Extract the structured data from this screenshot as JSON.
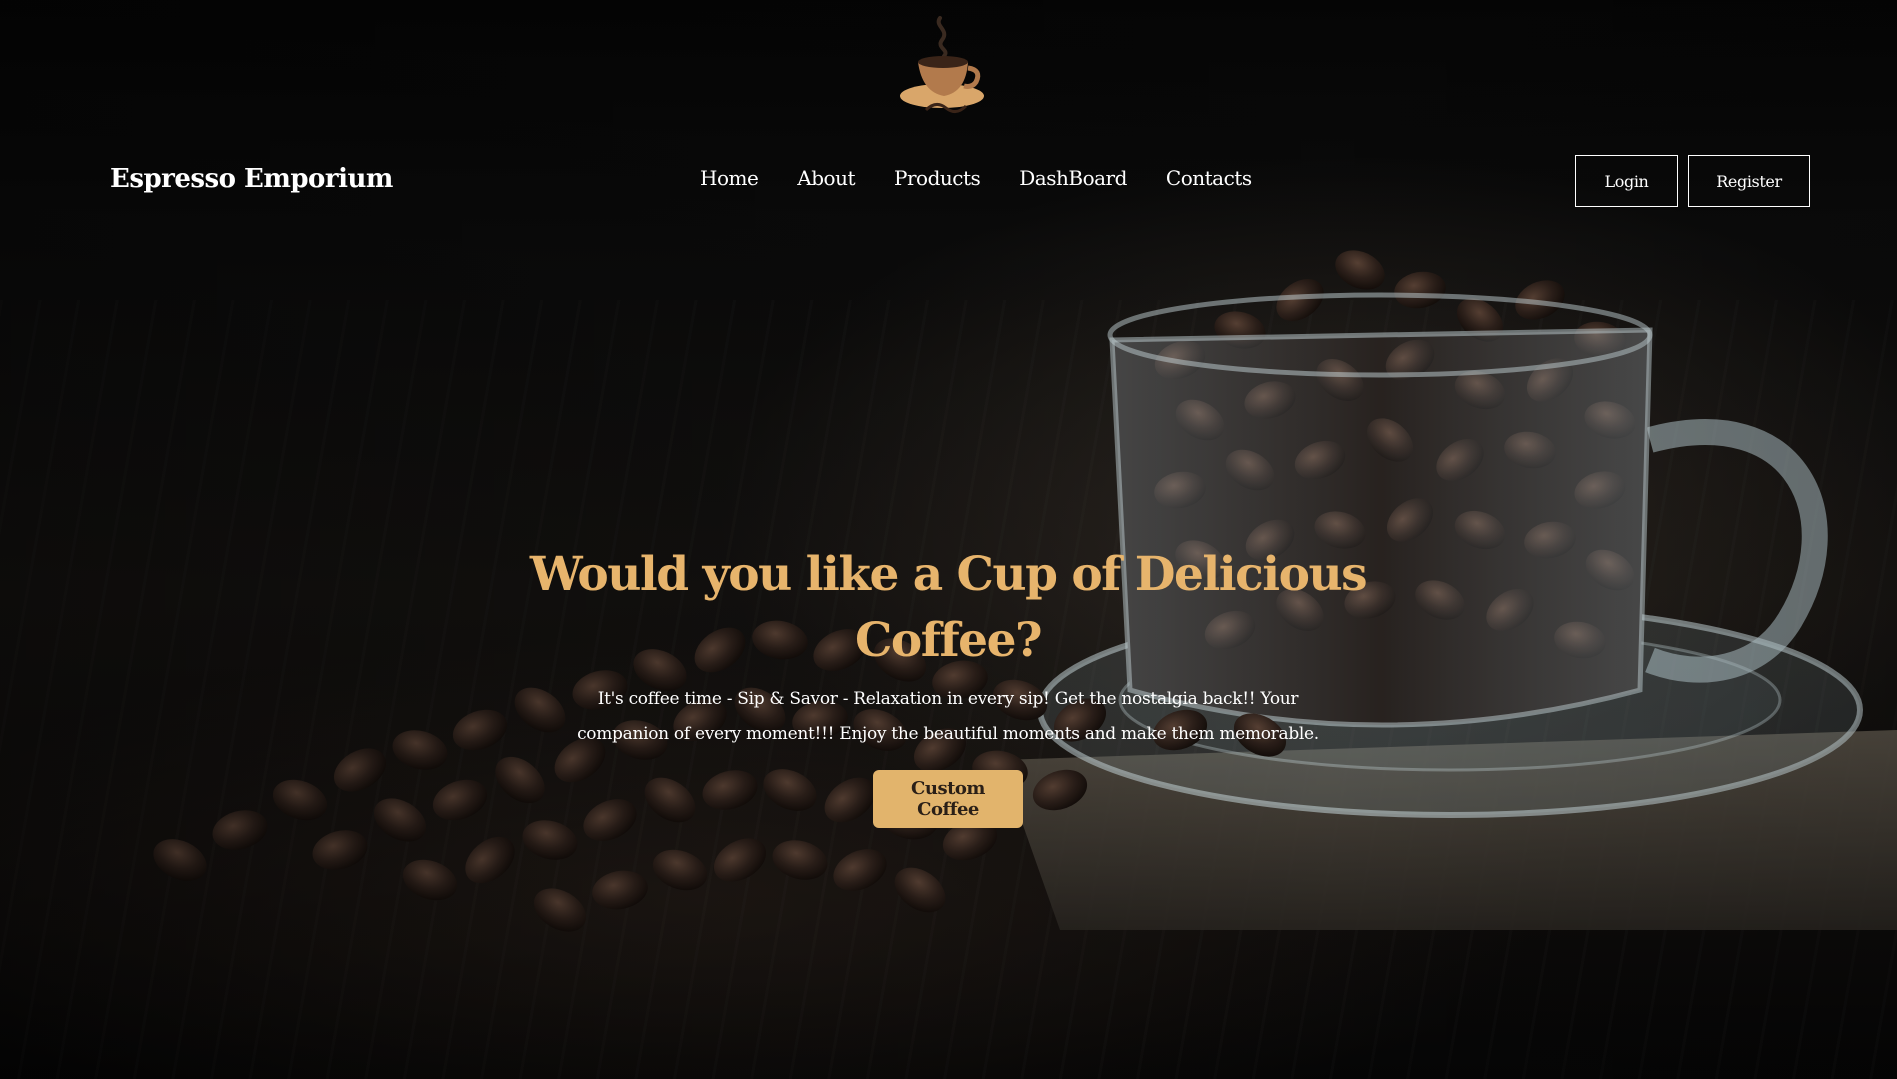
{
  "header": {
    "logo_text": "Coffee",
    "brand_name": "Espresso Emporium"
  },
  "nav": {
    "items": [
      {
        "label": "Home"
      },
      {
        "label": "About"
      },
      {
        "label": "Products"
      },
      {
        "label": "DashBoard"
      },
      {
        "label": "Contacts"
      }
    ]
  },
  "auth": {
    "login_label": "Login",
    "register_label": "Register"
  },
  "hero": {
    "title": "Would you like a Cup of Delicious Coffee?",
    "subtitle": "It's coffee time - Sip & Savor - Relaxation in every sip! Get the nostalgia back!! Your companion of every moment!!! Enjoy the beautiful moments and make them memorable.",
    "cta_label": "Custom Coffee"
  },
  "colors": {
    "accent": "#e7b46c",
    "cta_bg": "#e2b46c",
    "background": "#070707"
  }
}
